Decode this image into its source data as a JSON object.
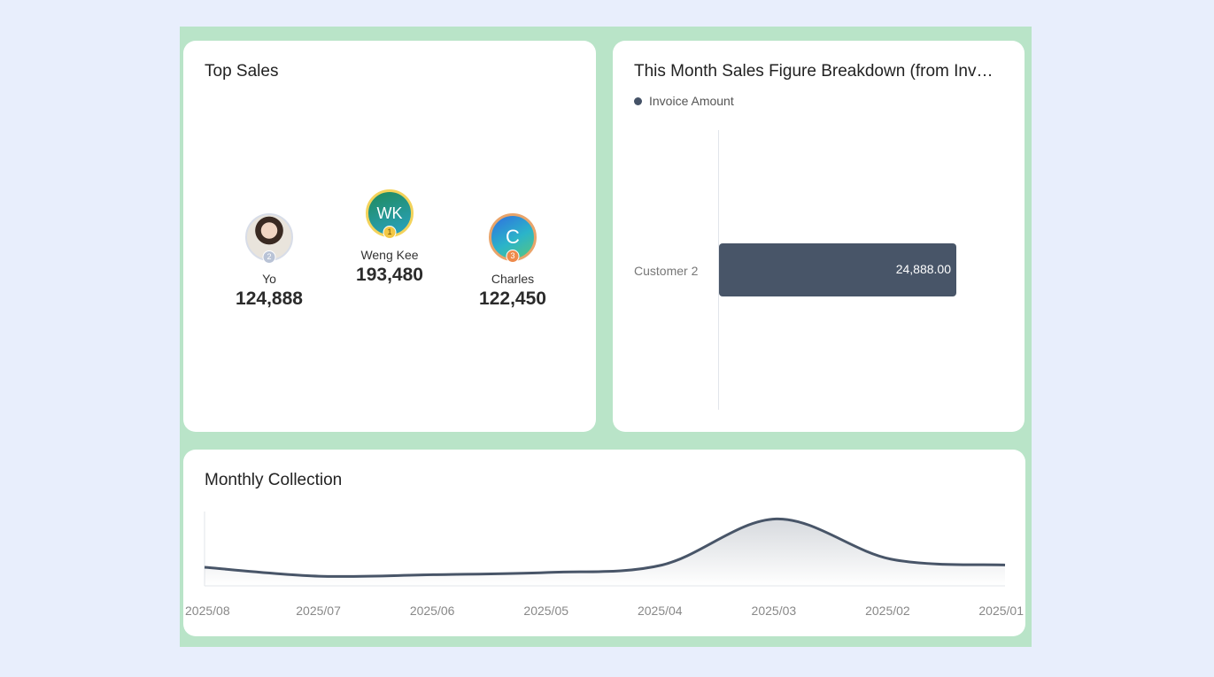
{
  "top_sales": {
    "title": "Top Sales",
    "people": [
      {
        "name": "Yo",
        "value": "124,888",
        "rank": "2",
        "avatar": "photo"
      },
      {
        "name": "Weng Kee",
        "value": "193,480",
        "rank": "1",
        "initials": "WK"
      },
      {
        "name": "Charles",
        "value": "122,450",
        "rank": "3",
        "initials": "C"
      }
    ]
  },
  "breakdown": {
    "title": "This Month Sales Figure Breakdown (from Invo...",
    "legend": "Invoice Amount",
    "colors": {
      "bar": "#485568"
    },
    "chart_data": {
      "type": "bar",
      "orientation": "horizontal",
      "categories": [
        "Customer 2"
      ],
      "series": [
        {
          "name": "Invoice Amount",
          "values": [
            24888.0
          ]
        }
      ],
      "value_labels": [
        "24,888.00"
      ]
    }
  },
  "monthly": {
    "title": "Monthly Collection",
    "colors": {
      "line": "#485568"
    },
    "chart_data": {
      "type": "area",
      "categories": [
        "2025/08",
        "2025/07",
        "2025/06",
        "2025/05",
        "2025/04",
        "2025/03",
        "2025/02",
        "2025/01"
      ],
      "values": [
        25,
        13,
        15,
        18,
        28,
        90,
        36,
        28
      ],
      "ylim": [
        0,
        100
      ]
    }
  }
}
